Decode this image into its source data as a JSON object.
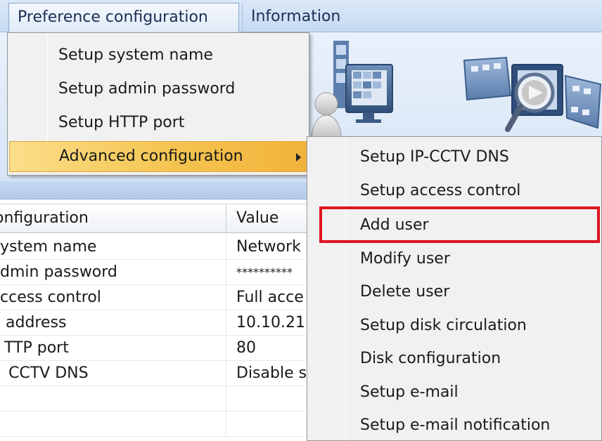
{
  "menubar": {
    "items": [
      {
        "label": "Preference configuration"
      },
      {
        "label": "Information"
      }
    ]
  },
  "dropdown": {
    "items": [
      {
        "label": "Setup system name"
      },
      {
        "label": "Setup admin password"
      },
      {
        "label": "Setup HTTP port"
      },
      {
        "label": "Advanced configuration",
        "has_submenu": true,
        "highlighted": true
      }
    ]
  },
  "submenu": {
    "items": [
      {
        "label": "Setup IP-CCTV DNS"
      },
      {
        "label": "Setup access control"
      },
      {
        "label": "Add user",
        "annotated": true
      },
      {
        "label": "Modify user"
      },
      {
        "label": "Delete user"
      },
      {
        "label": "Setup disk circulation"
      },
      {
        "label": "Disk configuration"
      },
      {
        "label": "Setup e-mail"
      },
      {
        "label": "Setup e-mail notification"
      }
    ]
  },
  "table": {
    "headers": [
      "onfiguration",
      "Value"
    ],
    "rows": [
      [
        "ystem name",
        "Network"
      ],
      [
        "dmin password",
        "**********"
      ],
      [
        "ccess control",
        "Full acce"
      ],
      [
        "address",
        "10.10.21"
      ],
      [
        "TTP port",
        "80"
      ],
      [
        "CCTV DNS",
        "Disable s"
      ],
      [
        "",
        ""
      ],
      [
        "",
        ""
      ]
    ]
  },
  "colors": {
    "highlight_border": "#e0141e",
    "hover_gradient_start": "#fbde8a",
    "hover_gradient_end": "#f0b33c",
    "menubar": "#c6daf2"
  },
  "icons": {
    "left_illustration": "user-monitor-icon",
    "right_illustration": "film-magnifier-icon"
  }
}
